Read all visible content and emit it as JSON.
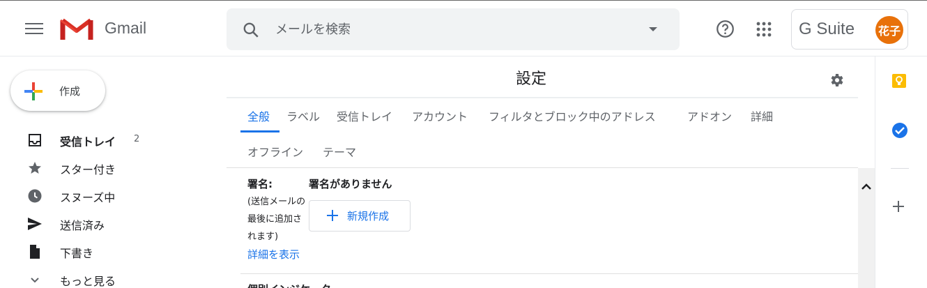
{
  "header": {
    "app_name": "Gmail",
    "search": {
      "placeholder": "メールを検索"
    },
    "gsuite_label": "G Suite",
    "avatar_text": "花子",
    "avatar_color": "#e8710a"
  },
  "icons": {
    "menu": "hamburger-menu-icon",
    "logo": "gmail-m-logo",
    "search": "search-icon",
    "search_options": "caret-down-icon",
    "help": "help-circle-icon",
    "apps": "apps-grid-icon",
    "settings": "gear-icon",
    "keep": "keep-bulb-icon",
    "tasks": "tasks-check-icon",
    "add_addon": "plus-icon"
  },
  "sidebar": {
    "compose_label": "作成",
    "items": [
      {
        "label": "受信トレイ",
        "count": "2",
        "icon": "inbox-icon",
        "bold": true
      },
      {
        "label": "スター付き",
        "icon": "star-icon"
      },
      {
        "label": "スヌーズ中",
        "icon": "clock-icon"
      },
      {
        "label": "送信済み",
        "icon": "send-icon"
      },
      {
        "label": "下書き",
        "icon": "draft-file-icon"
      },
      {
        "label": "もっと見る",
        "icon": "chevron-down-icon"
      }
    ]
  },
  "settings": {
    "title": "設定",
    "tabs": [
      {
        "label": "全般",
        "active": true
      },
      {
        "label": "ラベル"
      },
      {
        "label": "受信トレイ"
      },
      {
        "label": "アカウント"
      },
      {
        "label": "フィルタとブロック中のアドレス"
      },
      {
        "label": "アドオン"
      },
      {
        "label": "詳細"
      },
      {
        "label": "オフライン"
      },
      {
        "label": "テーマ"
      }
    ],
    "signature": {
      "label": "署名:",
      "note": "(送信メールの最後に追加されます)",
      "more_link": "詳細を表示",
      "none_text": "署名がありません",
      "new_button": "新規作成"
    },
    "next_section_partial": "個別インジケーター"
  },
  "colors": {
    "accent": "#1a73e8",
    "text": "#202124",
    "muted": "#5f6368"
  }
}
